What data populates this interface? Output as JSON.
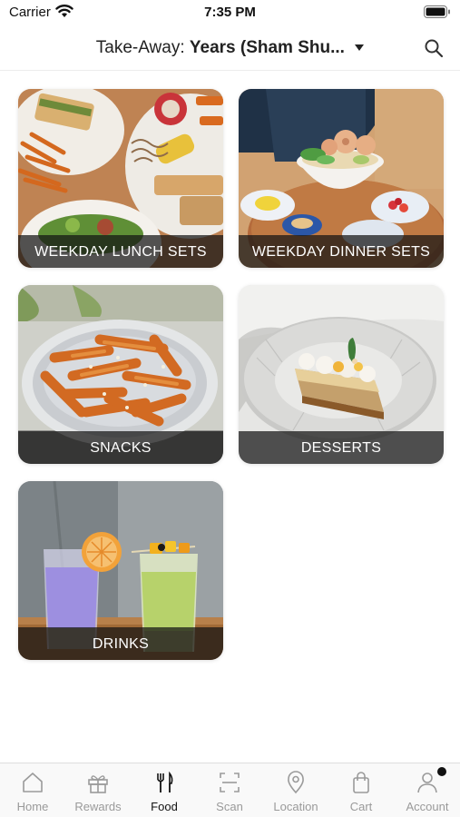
{
  "status_bar": {
    "carrier": "Carrier",
    "time": "7:35 PM"
  },
  "header": {
    "order_mode": "Take-Away:",
    "store_name": "Years (Sham Shu..."
  },
  "categories": [
    {
      "label": "WEEKDAY LUNCH SETS"
    },
    {
      "label": "WEEKDAY DINNER SETS"
    },
    {
      "label": "SNACKS"
    },
    {
      "label": "DESSERTS"
    },
    {
      "label": "DRINKS"
    }
  ],
  "tab_bar": {
    "active": "Food",
    "tabs": [
      {
        "label": "Home",
        "icon": "home-icon"
      },
      {
        "label": "Rewards",
        "icon": "gift-icon"
      },
      {
        "label": "Food",
        "icon": "fork-knife-icon"
      },
      {
        "label": "Scan",
        "icon": "scan-icon"
      },
      {
        "label": "Location",
        "icon": "location-pin-icon"
      },
      {
        "label": "Cart",
        "icon": "shopping-bag-icon"
      },
      {
        "label": "Account",
        "icon": "person-icon"
      }
    ],
    "account_badge_color": "#111111"
  }
}
